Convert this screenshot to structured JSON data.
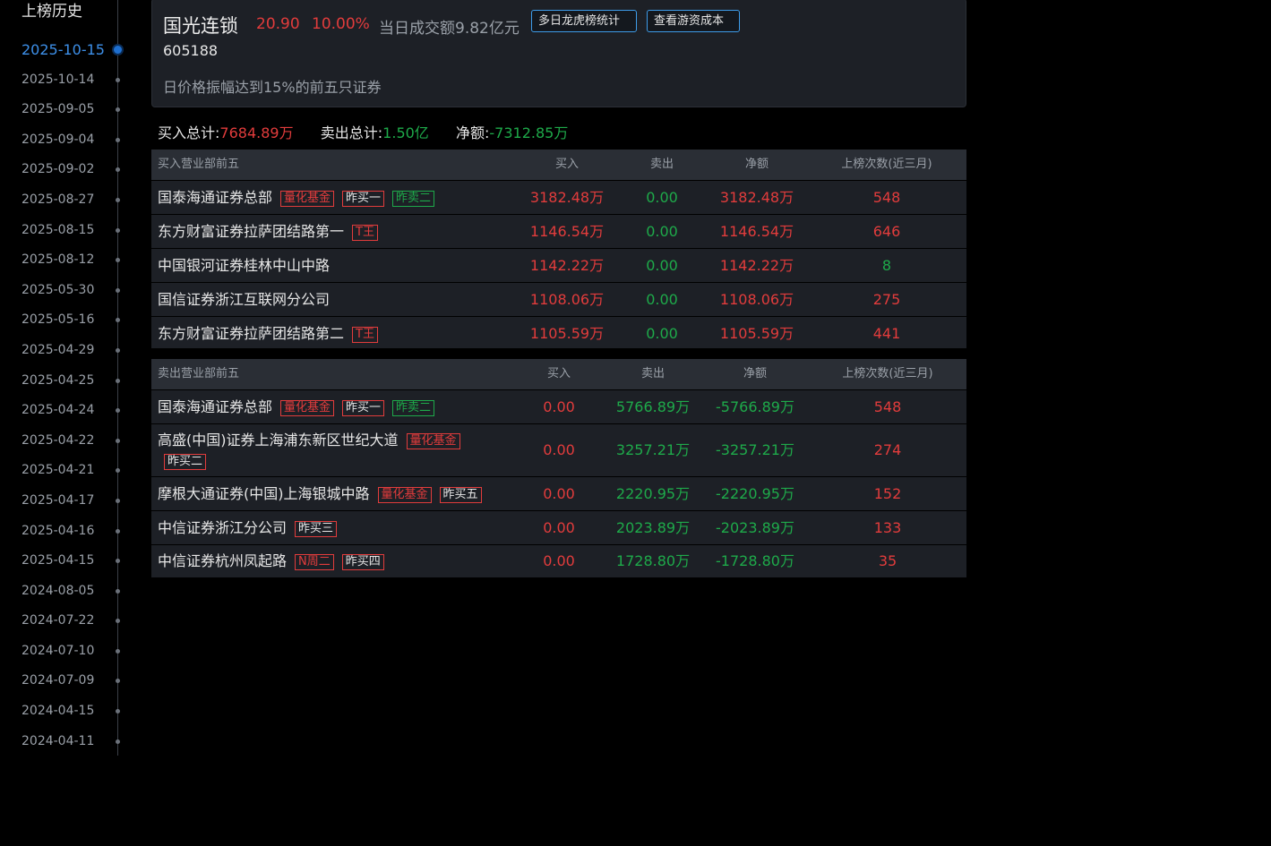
{
  "sidebar": {
    "title": "上榜历史",
    "dates": [
      "2025-10-15",
      "2025-10-14",
      "2025-09-05",
      "2025-09-04",
      "2025-09-02",
      "2025-08-27",
      "2025-08-15",
      "2025-08-12",
      "2025-05-30",
      "2025-05-16",
      "2025-04-29",
      "2025-04-25",
      "2025-04-24",
      "2025-04-22",
      "2025-04-21",
      "2025-04-17",
      "2025-04-16",
      "2025-04-15",
      "2024-08-05",
      "2024-07-22",
      "2024-07-10",
      "2024-07-09",
      "2024-04-15",
      "2024-04-11"
    ],
    "active_index": 0
  },
  "stock": {
    "name": "国光连锁",
    "price": "20.90",
    "change_pct": "10.00%",
    "turnover": "当日成交额9.82亿元",
    "code": "605188",
    "reason": "日价格振幅达到15%的前五只证券",
    "btn_multi_day": "多日龙虎榜统计",
    "btn_cost": "查看游资成本"
  },
  "summary": {
    "buy_label": "买入总计:",
    "buy_value": "7684.89万",
    "sell_label": "卖出总计:",
    "sell_value": "1.50亿",
    "net_label": "净额:",
    "net_value": "-7312.85万"
  },
  "buy_table": {
    "headers": [
      "买入营业部前五",
      "买入",
      "卖出",
      "净额",
      "上榜次数(近三月)"
    ],
    "rows": [
      {
        "name": "国泰海通证券总部",
        "tags": [
          {
            "t": "量化基金",
            "s": "red"
          },
          {
            "t": "昨买一",
            "s": "white-red"
          },
          {
            "t": "昨卖二",
            "s": "grn"
          }
        ],
        "buy": "3182.48万",
        "sell": "0.00",
        "net": "3182.48万",
        "count": "548"
      },
      {
        "name": "东方财富证券拉萨团结路第一",
        "tags": [
          {
            "t": "T王",
            "s": "red"
          }
        ],
        "buy": "1146.54万",
        "sell": "0.00",
        "net": "1146.54万",
        "count": "646"
      },
      {
        "name": "中国银河证券桂林中山中路",
        "tags": [],
        "buy": "1142.22万",
        "sell": "0.00",
        "net": "1142.22万",
        "count": "8",
        "count_color": "green"
      },
      {
        "name": "国信证券浙江互联网分公司",
        "tags": [],
        "buy": "1108.06万",
        "sell": "0.00",
        "net": "1108.06万",
        "count": "275"
      },
      {
        "name": "东方财富证券拉萨团结路第二",
        "tags": [
          {
            "t": "T王",
            "s": "red"
          }
        ],
        "buy": "1105.59万",
        "sell": "0.00",
        "net": "1105.59万",
        "count": "441"
      }
    ]
  },
  "sell_table": {
    "headers": [
      "卖出营业部前五",
      "买入",
      "卖出",
      "净额",
      "上榜次数(近三月)"
    ],
    "rows": [
      {
        "name": "国泰海通证券总部",
        "tags": [
          {
            "t": "量化基金",
            "s": "red"
          },
          {
            "t": "昨买一",
            "s": "white-red"
          },
          {
            "t": "昨卖二",
            "s": "grn"
          }
        ],
        "buy": "0.00",
        "sell": "5766.89万",
        "net": "-5766.89万",
        "count": "548"
      },
      {
        "name": "高盛(中国)证券上海浦东新区世纪大道",
        "tags": [
          {
            "t": "量化基金",
            "s": "red"
          },
          {
            "t": "昨买二",
            "s": "white-red"
          }
        ],
        "buy": "0.00",
        "sell": "3257.21万",
        "net": "-3257.21万",
        "count": "274"
      },
      {
        "name": "摩根大通证券(中国)上海银城中路",
        "tags": [
          {
            "t": "量化基金",
            "s": "red"
          },
          {
            "t": "昨买五",
            "s": "white-red"
          }
        ],
        "buy": "0.00",
        "sell": "2220.95万",
        "net": "-2220.95万",
        "count": "152"
      },
      {
        "name": "中信证券浙江分公司",
        "tags": [
          {
            "t": "昨买三",
            "s": "white-red"
          }
        ],
        "buy": "0.00",
        "sell": "2023.89万",
        "net": "-2023.89万",
        "count": "133"
      },
      {
        "name": "中信证券杭州凤起路",
        "tags": [
          {
            "t": "N周二",
            "s": "red"
          },
          {
            "t": "昨买四",
            "s": "white-red"
          }
        ],
        "buy": "0.00",
        "sell": "1728.80万",
        "net": "-1728.80万",
        "count": "35"
      }
    ]
  },
  "colors": {
    "up": "#e23c3c",
    "down": "#1eaa4a",
    "accent": "#3d8fe8"
  }
}
